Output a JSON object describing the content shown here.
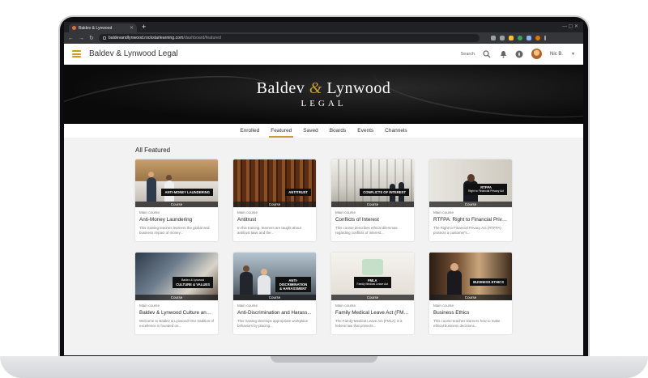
{
  "browser": {
    "tab_title": "Baldev & Lynwood",
    "url_host": "baldevandlynwood.rockstarlearning.com",
    "url_path": "/dashboard/featured"
  },
  "header": {
    "app_title": "Baldev & Lynwood Legal",
    "search_label": "Search",
    "user_name": "Nic B."
  },
  "banner": {
    "line1_left": "Baldev",
    "line1_amp": "&",
    "line1_right": "Lynwood",
    "line2": "LEGAL"
  },
  "subnav": {
    "items": [
      "Enrolled",
      "Featured",
      "Saved",
      "Boards",
      "Events",
      "Channels"
    ],
    "active": "Featured"
  },
  "section_title": "All Featured",
  "courses": [
    {
      "thumb_label": "ANTI-MONEY LAUNDERING",
      "thumb_sub": "",
      "tag": "Course",
      "type": "Main course",
      "name": "Anti-Money Laundering",
      "desc": "This training teaches learners the global and business impact of money..."
    },
    {
      "thumb_label": "ANTITRUST",
      "thumb_sub": "",
      "tag": "Course",
      "type": "Main course",
      "name": "Antitrust",
      "desc": "In this training, learners are taught about antitrust laws and the..."
    },
    {
      "thumb_label": "CONFLICTS OF INTEREST",
      "thumb_sub": "",
      "tag": "Course",
      "type": "Main course",
      "name": "Conflicts of Interest",
      "desc": "This course describes ethical dilemmas regarding conflicts of interest..."
    },
    {
      "thumb_label": "RTFPA",
      "thumb_sub": "Right to Financial Privacy Act",
      "tag": "Course",
      "type": "Main course",
      "name": "RTFPA: Right to Financial Priva...",
      "desc": "The Right to Financial Privacy Act (RTFPA) protects a customer's..."
    },
    {
      "thumb_label": "CULTURE & VALUES",
      "thumb_sub": "Baldev & Lynwood",
      "tag": "Course",
      "type": "Main course",
      "name": "Baldev & Lynwood Culture and ...",
      "desc": "Welcome to Baldev & Lynwood! Our tradition of excellence is founded on..."
    },
    {
      "thumb_label": "ANTI-DISCRIMINATION & HARASSMENT",
      "thumb_sub": "",
      "tag": "Course",
      "type": "Main course",
      "name": "Anti-Discrimination and Harass...",
      "desc": "This training develops appropriate workplace behaviors by placing..."
    },
    {
      "thumb_label": "FMLA",
      "thumb_sub": "Family Medical Leave Act",
      "tag": "Course",
      "type": "Main course",
      "name": "Family Medical Leave Act (FMLA...",
      "desc": "The Family Medical Leave Act (FMLA) is a federal law that protects..."
    },
    {
      "thumb_label": "BUSINESS ETHICS",
      "thumb_sub": "",
      "tag": "Course",
      "type": "Main course",
      "name": "Business Ethics",
      "desc": "This course teaches learners how to make ethical business decisions..."
    }
  ],
  "colors": {
    "accent": "#c89b3c",
    "hamburger": "#d49a12"
  }
}
